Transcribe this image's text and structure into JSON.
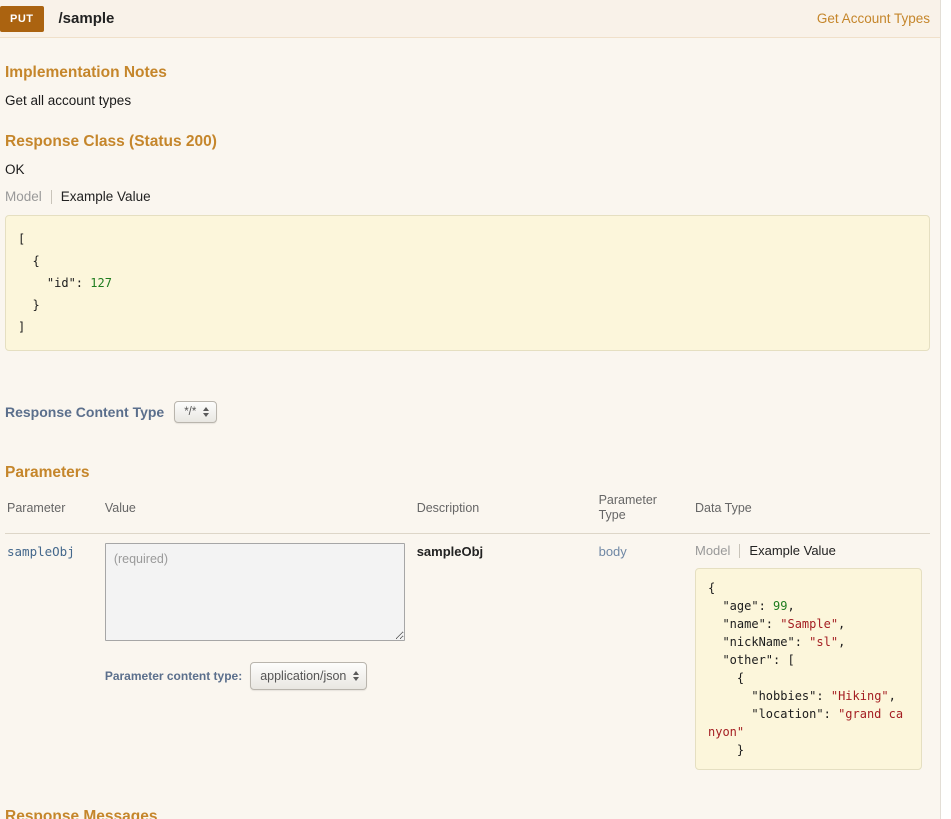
{
  "header": {
    "method": "PUT",
    "path": "/sample",
    "link_label": "Get Account Types"
  },
  "sections": {
    "implementation_notes": {
      "title": "Implementation Notes",
      "body": "Get all account types"
    },
    "response_class": {
      "title": "Response Class (Status 200)",
      "status_text": "OK",
      "tabs": {
        "model": "Model",
        "example": "Example Value"
      }
    },
    "response_content_type": {
      "label": "Response Content Type",
      "selected_option": "*/*"
    },
    "parameters": {
      "title": "Parameters",
      "columns": [
        "Parameter",
        "Value",
        "Description",
        "Parameter Type",
        "Data Type"
      ],
      "row": {
        "name": "sampleObj",
        "value_placeholder": "(required)",
        "description": "sampleObj",
        "parameter_type": "body",
        "content_type_label": "Parameter content type:",
        "content_type_selected": "application/json",
        "tabs": {
          "model": "Model",
          "example": "Example Value"
        }
      }
    },
    "response_messages": {
      "title": "Response Messages"
    }
  },
  "code_blocks": {
    "response_example": [
      {
        "t": "plain",
        "v": "[\n  {\n    \"id\": "
      },
      {
        "t": "num",
        "v": "127"
      },
      {
        "t": "plain",
        "v": "\n  }\n]"
      }
    ],
    "parameter_example": [
      {
        "t": "plain",
        "v": "{\n  \"age\": "
      },
      {
        "t": "num",
        "v": "99"
      },
      {
        "t": "plain",
        "v": ",\n  \"name\": "
      },
      {
        "t": "str",
        "v": "\"Sample\""
      },
      {
        "t": "plain",
        "v": ",\n  \"nickName\": "
      },
      {
        "t": "str",
        "v": "\"sl\""
      },
      {
        "t": "plain",
        "v": ",\n  \"other\": [\n    {\n      \"hobbies\": "
      },
      {
        "t": "str",
        "v": "\"Hiking\""
      },
      {
        "t": "plain",
        "v": ",\n      \"location\": "
      },
      {
        "t": "str",
        "v": "\"grand canyon\""
      },
      {
        "t": "plain",
        "v": "\n    }"
      }
    ]
  },
  "colors": {
    "accent": "#c5862b",
    "method_badge_bg": "#ab6310",
    "content_bg": "#faf6ef",
    "heading_bg": "#f9f2e9",
    "code_bg": "#fcf6db",
    "code_number": "#1f7d1f",
    "code_string": "#a41e22",
    "label_blue": "#5b6f8c"
  }
}
